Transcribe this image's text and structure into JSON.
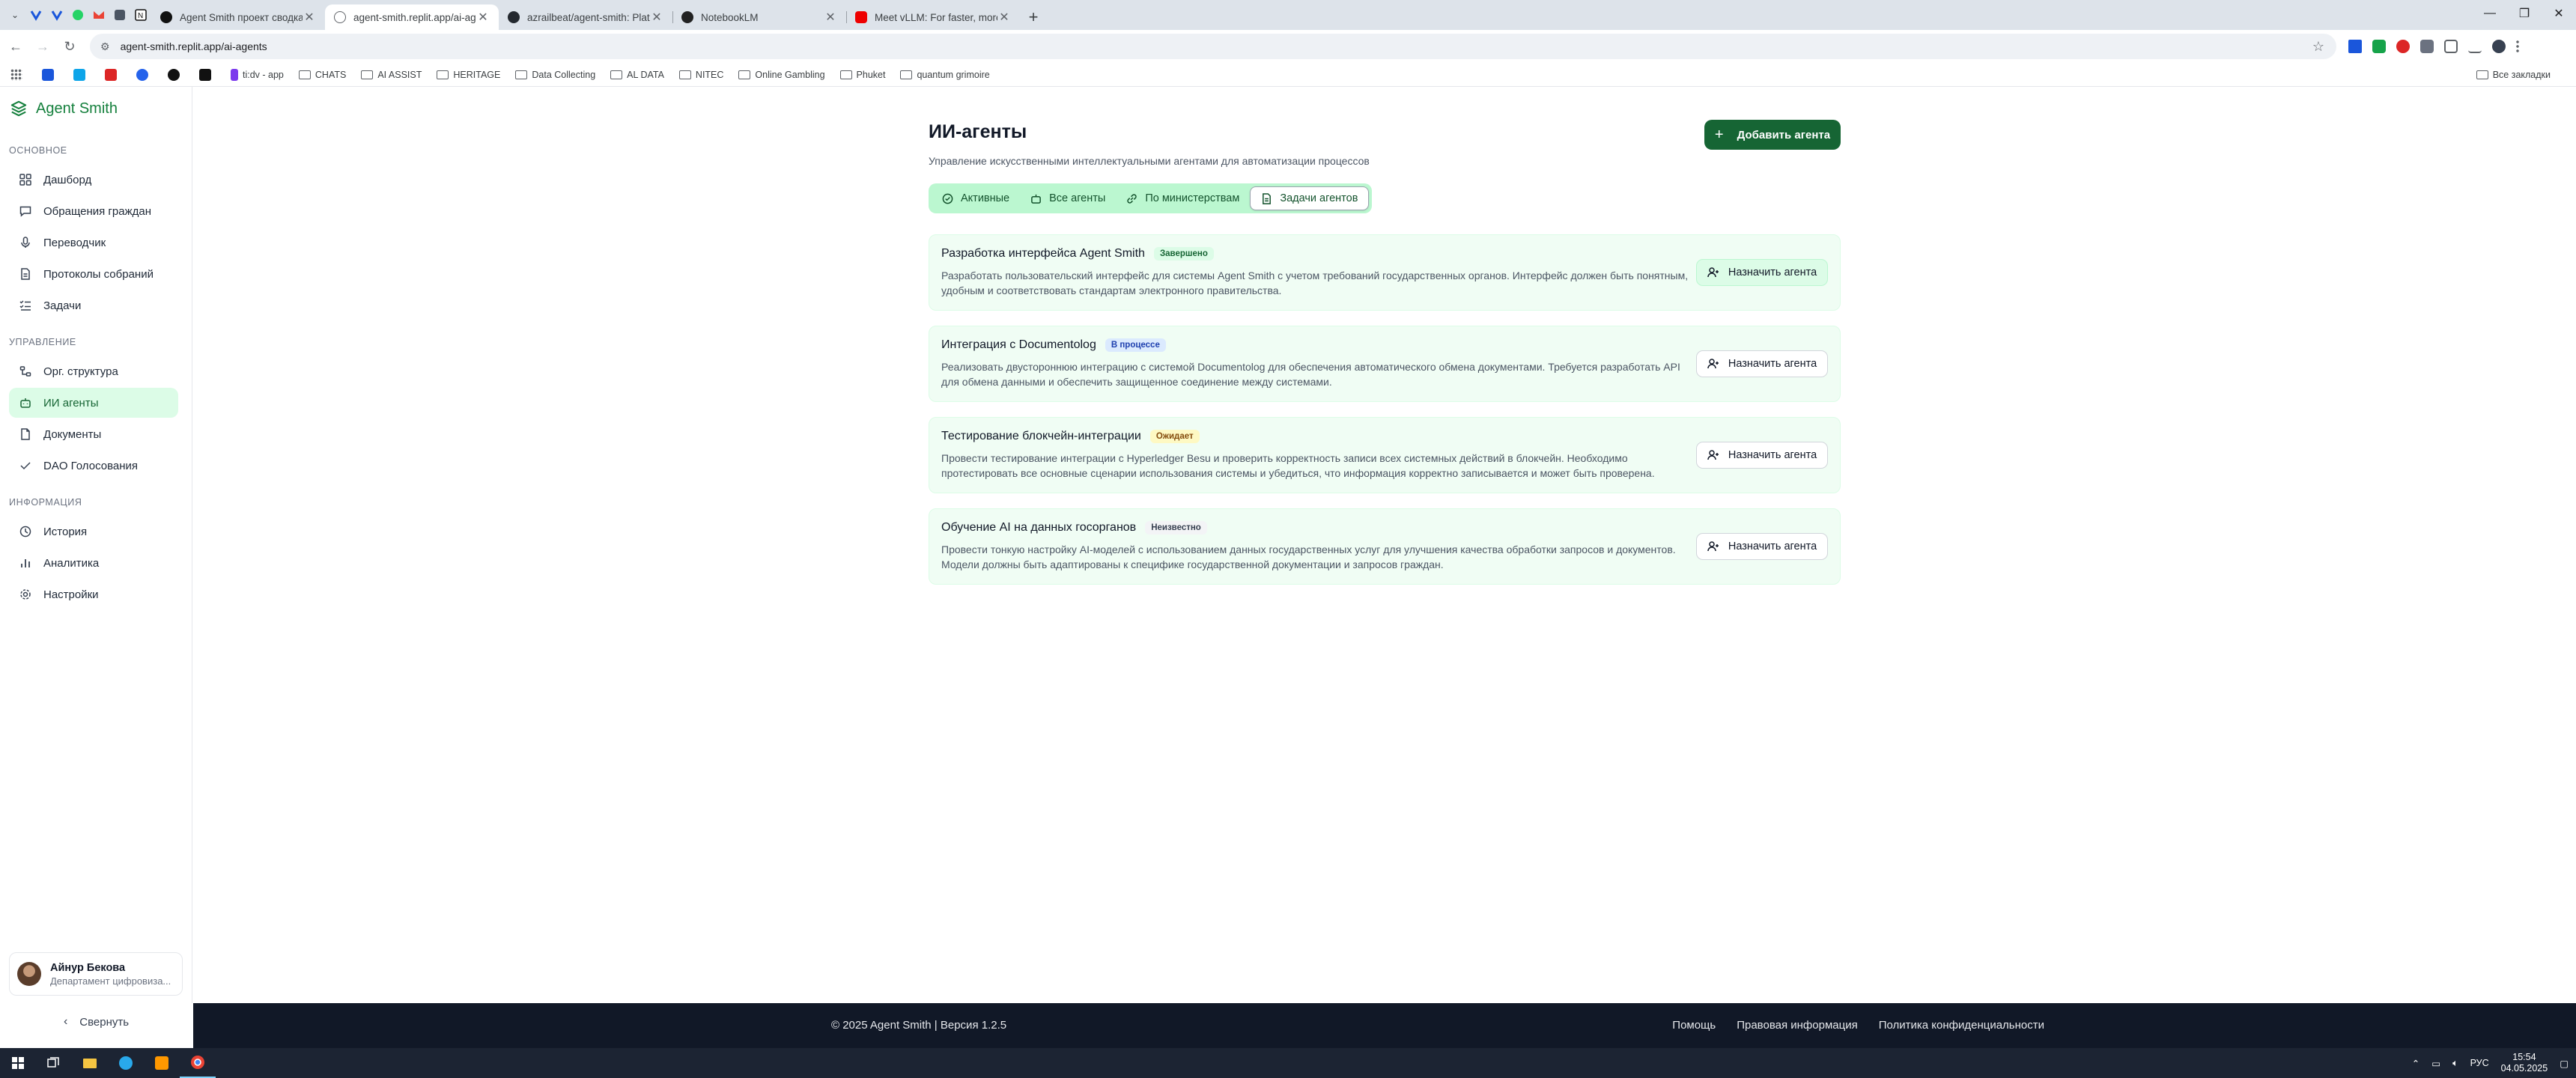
{
  "browser": {
    "tabs": [
      {
        "title": "Agent Smith проект сводка",
        "active": false
      },
      {
        "title": "agent-smith.replit.app/ai-agen",
        "active": true
      },
      {
        "title": "azrailbeat/agent-smith: Platfo",
        "active": false
      },
      {
        "title": "NotebookLM",
        "active": false
      },
      {
        "title": "Meet vLLM: For faster, more eff",
        "active": false
      }
    ],
    "url": "agent-smith.replit.app/ai-agents",
    "bookmarks": [
      "ti:dv - app",
      "CHATS",
      "AI ASSIST",
      "HERITAGE",
      "Data Collecting",
      "AL DATA",
      "NITEC",
      "Online Gambling",
      "Phuket",
      "quantum grimoire"
    ],
    "all_bookmarks": "Все закладки"
  },
  "app": {
    "brand": "Agent Smith",
    "sections": [
      {
        "title": "ОСНОВНОЕ",
        "items": [
          {
            "label": "Дашборд",
            "icon": "grid-icon"
          },
          {
            "label": "Обращения граждан",
            "icon": "message-icon"
          },
          {
            "label": "Переводчик",
            "icon": "mic-icon"
          },
          {
            "label": "Протоколы собраний",
            "icon": "file-icon"
          },
          {
            "label": "Задачи",
            "icon": "list-checks-icon"
          }
        ]
      },
      {
        "title": "УПРАВЛЕНИЕ",
        "items": [
          {
            "label": "Орг. структура",
            "icon": "org-icon"
          },
          {
            "label": "ИИ агенты",
            "icon": "bot-icon",
            "active": true
          },
          {
            "label": "Документы",
            "icon": "doc-icon"
          },
          {
            "label": "DAO Голосования",
            "icon": "vote-icon"
          }
        ]
      },
      {
        "title": "ИНФОРМАЦИЯ",
        "items": [
          {
            "label": "История",
            "icon": "history-icon"
          },
          {
            "label": "Аналитика",
            "icon": "chart-icon"
          },
          {
            "label": "Настройки",
            "icon": "gear-icon"
          }
        ]
      }
    ],
    "user": {
      "name": "Айнур Бекова",
      "dept": "Департамент цифровиза..."
    },
    "collapse": "Свернуть"
  },
  "page": {
    "title": "ИИ-агенты",
    "subtitle": "Управление искусственными интеллектуальными агентами для автоматизации процессов",
    "add_button": "Добавить агента",
    "tabs": [
      {
        "label": "Активные",
        "icon": "check-circle-icon"
      },
      {
        "label": "Все агенты",
        "icon": "bot-icon"
      },
      {
        "label": "По министерствам",
        "icon": "link-icon"
      },
      {
        "label": "Задачи агентов",
        "icon": "file-text-icon",
        "active": true
      }
    ],
    "assign_label": "Назначить агента",
    "tasks": [
      {
        "title": "Разработка интерфейса Agent Smith",
        "status": "Завершено",
        "status_color": "#166534",
        "description": "Разработать пользовательский интерфейс для системы Agent Smith с учетом требований государственных органов. Интерфейс должен быть понятным, удобным и соответствовать стандартам электронного правительства."
      },
      {
        "title": "Интеграция с Documentolog",
        "status": "В процессе",
        "status_color": "#1e40af",
        "description": "Реализовать двустороннюю интеграцию с системой Documentolog для обеспечения автоматического обмена документами. Требуется разработать API для обмена данными и обеспечить защищенное соединение между системами."
      },
      {
        "title": "Тестирование блокчейн-интеграции",
        "status": "Ожидает",
        "status_color": "#854d0e",
        "description": "Провести тестирование интеграции с Hyperledger Besu и проверить корректность записи всех системных действий в блокчейн. Необходимо протестировать все основные сценарии использования системы и убедиться, что информация корректно записывается и может быть проверена."
      },
      {
        "title": "Обучение AI на данных госорганов",
        "status": "Неизвестно",
        "status_color": "#374151",
        "description": "Провести тонкую настройку AI-моделей с использованием данных государственных услуг для улучшения качества обработки запросов и документов. Модели должны быть адаптированы к специфике государственной документации и запросов граждан."
      }
    ]
  },
  "footer": {
    "copyright": "© 2025 Agent Smith | Версия 1.2.5",
    "links": [
      "Помощь",
      "Правовая информация",
      "Политика конфиденциальности"
    ]
  },
  "taskbar": {
    "lang": "РУС",
    "time": "15:54",
    "date": "04.05.2025"
  }
}
